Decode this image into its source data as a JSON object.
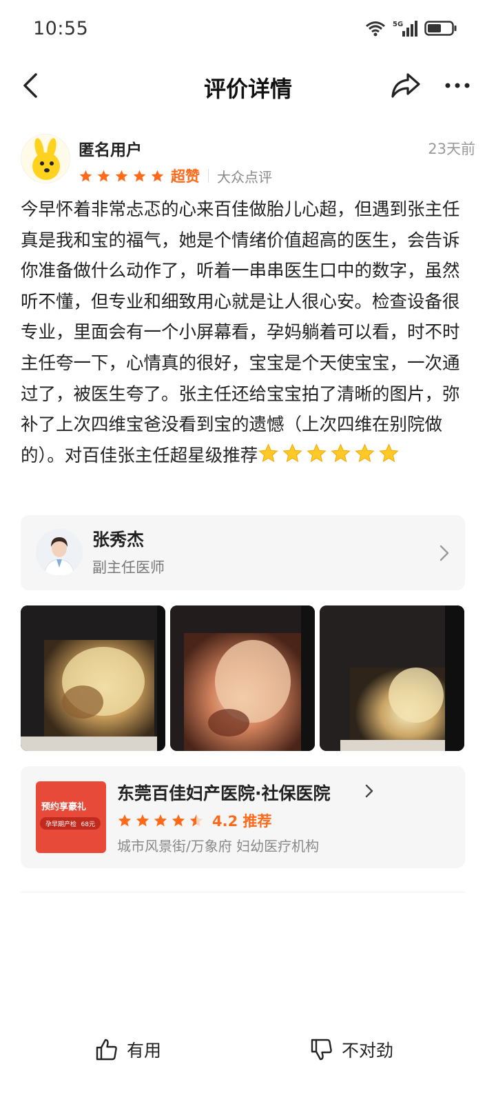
{
  "status_bar": {
    "time": "10:55",
    "icons": [
      "wifi-icon",
      "5g-signal-icon",
      "battery-icon"
    ]
  },
  "nav": {
    "title": "评价详情",
    "icons": [
      "back-arrow-icon",
      "share-icon",
      "more-icon"
    ]
  },
  "review": {
    "author": "匿名用户",
    "time": "23天前",
    "star_count": 5,
    "rating_text": "超赞",
    "source": "大众点评",
    "text": "今早怀着非常忐忑的心来百佳做胎儿心超，但遇到张主任真是我和宝的福气，她是个情绪价值超高的医生，会告诉你准备做什么动作了，听着一串串医生口中的数字，虽然听不懂，但专业和细致用心就是让人很心安。检查设备很专业，里面会有一个小屏幕看，孕妈躺着可以看，时不时主任夸一下，心情真的很好，宝宝是个天使宝宝，一次通过了，被医生夸了。张主任还给宝宝拍了清晰的图片，弥补了上次四维宝爸没看到宝的遗憾（上次四维在别院做的）。对百佳张主任超星级推荐",
    "emoji_stars": 6
  },
  "doctor": {
    "name": "张秀杰",
    "title": "副主任医师"
  },
  "photos": [
    "ultrasound-photo-1",
    "ultrasound-photo-2",
    "ultrasound-photo-3"
  ],
  "hospital": {
    "name": "东莞百佳妇产医院·社保医院",
    "score": "4.2 推荐",
    "score_value": 4.2,
    "meta": "城市风景街/万象府 妇幼医疗机构",
    "thumb_promo": "预约享豪礼",
    "thumb_item": "孕早期产检",
    "thumb_price": "68元"
  },
  "actions": {
    "useful": "有用",
    "wrong": "不对劲"
  },
  "colors": {
    "accent": "#ff6a1a",
    "card_bg": "#f6f6f6",
    "thumb_red": "#e84a3a"
  }
}
